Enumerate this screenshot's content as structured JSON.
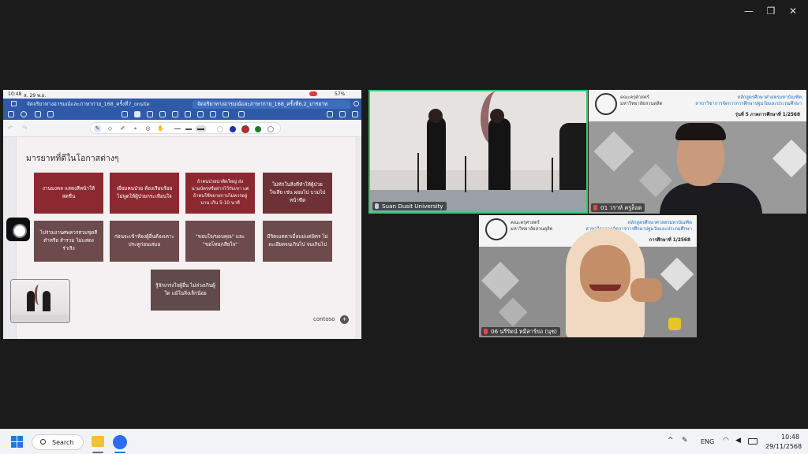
{
  "window": {
    "controls": {
      "minimize": "—",
      "restore": "❐",
      "close": "✕"
    }
  },
  "shared_screen": {
    "status_time": "10:48",
    "status_date": "ส. 29 พ.ย.",
    "status_battery": "57%",
    "tabs": [
      "จัดจริยาทางอารมณ์และภาษากาย_168_ครั้งที่7_onsite",
      "จัดจริยาทางอารมณ์และภาษากาย_168_ครั้งที่6.2_มารยาท"
    ],
    "slide": {
      "title": "มารยาทที่ดีในโอกาสต่างๆ",
      "boxes": [
        "งานมงคล แสดงสีหน้าให้สดชื่น",
        "เยี่ยมคนป่วย ต้องเรียบร้อย ไม่พูดให้ผู้ป่วยกระเทือนใจ",
        "ถ้าคนป่วยน่าติดใหญ่ ส่งนามบัตรหรือฝากไว้กับเขา แต่ถ้าคนใช้ขยายกาบไม่ควรอยู่นาน เกิน 5-10 นาที",
        "ไม่ทักในสิ่งที่ทำให้ผู้ป่วยใจเสีย เช่น ผอมไป บวมไป หน้าซีด",
        "ไปร่วมงานศพควรสวมชุดสีดำหรือ สำรวม ไม่แสดงร่าเริง",
        "ก่อนจะเข้าห้องผู้อื่นต้องเคาะประตูก่อนเสมอ",
        "\"ขอบใจ/ขอบคุณ\" และ \"ขอโทษ/เสียใจ\"",
        "มีจิตเมตตาเมื่อแม่แต่มิตร ไม่ละเอียดจนเกินไป จนเกินไป",
        "รู้จักเกรงใจผู้อื่น ไม่ล่วงเกินผู้ใด แม้ในสิ่งเล็กน้อย"
      ],
      "logo": "contoso"
    }
  },
  "participants": [
    {
      "label": "Suan Dusit University"
    },
    {
      "label": "01 วราห์ ครูล็อต"
    },
    {
      "label": "06 นรีรัตน์ หมีสาร์ยอ (นุช)"
    }
  ],
  "tile_header": {
    "org_left": "คณะครุศาสตร์\nมหาวิทยาลัยสวนดุสิต",
    "org_right": "หลักสูตรศึกษาศาสตรมหาบัณฑิต\nสาขาวิชาการจัดการการศึกษาปฐมวัยและประถมศึกษา",
    "cohort": "รุ่นที่ 5 ภาคการศึกษาที่ 1/2568",
    "cohort_partial": "การศึกษาที่ 1/2568"
  },
  "taskbar": {
    "search_label": "Search",
    "language": "ENG",
    "time": "10:48",
    "date": "29/11/2568"
  },
  "colors": {
    "box_dark": "#8c2930",
    "box_mid": "#6e3236",
    "tile_active_border": "#2ecc71",
    "tab_blue": "#2e5aa8"
  }
}
